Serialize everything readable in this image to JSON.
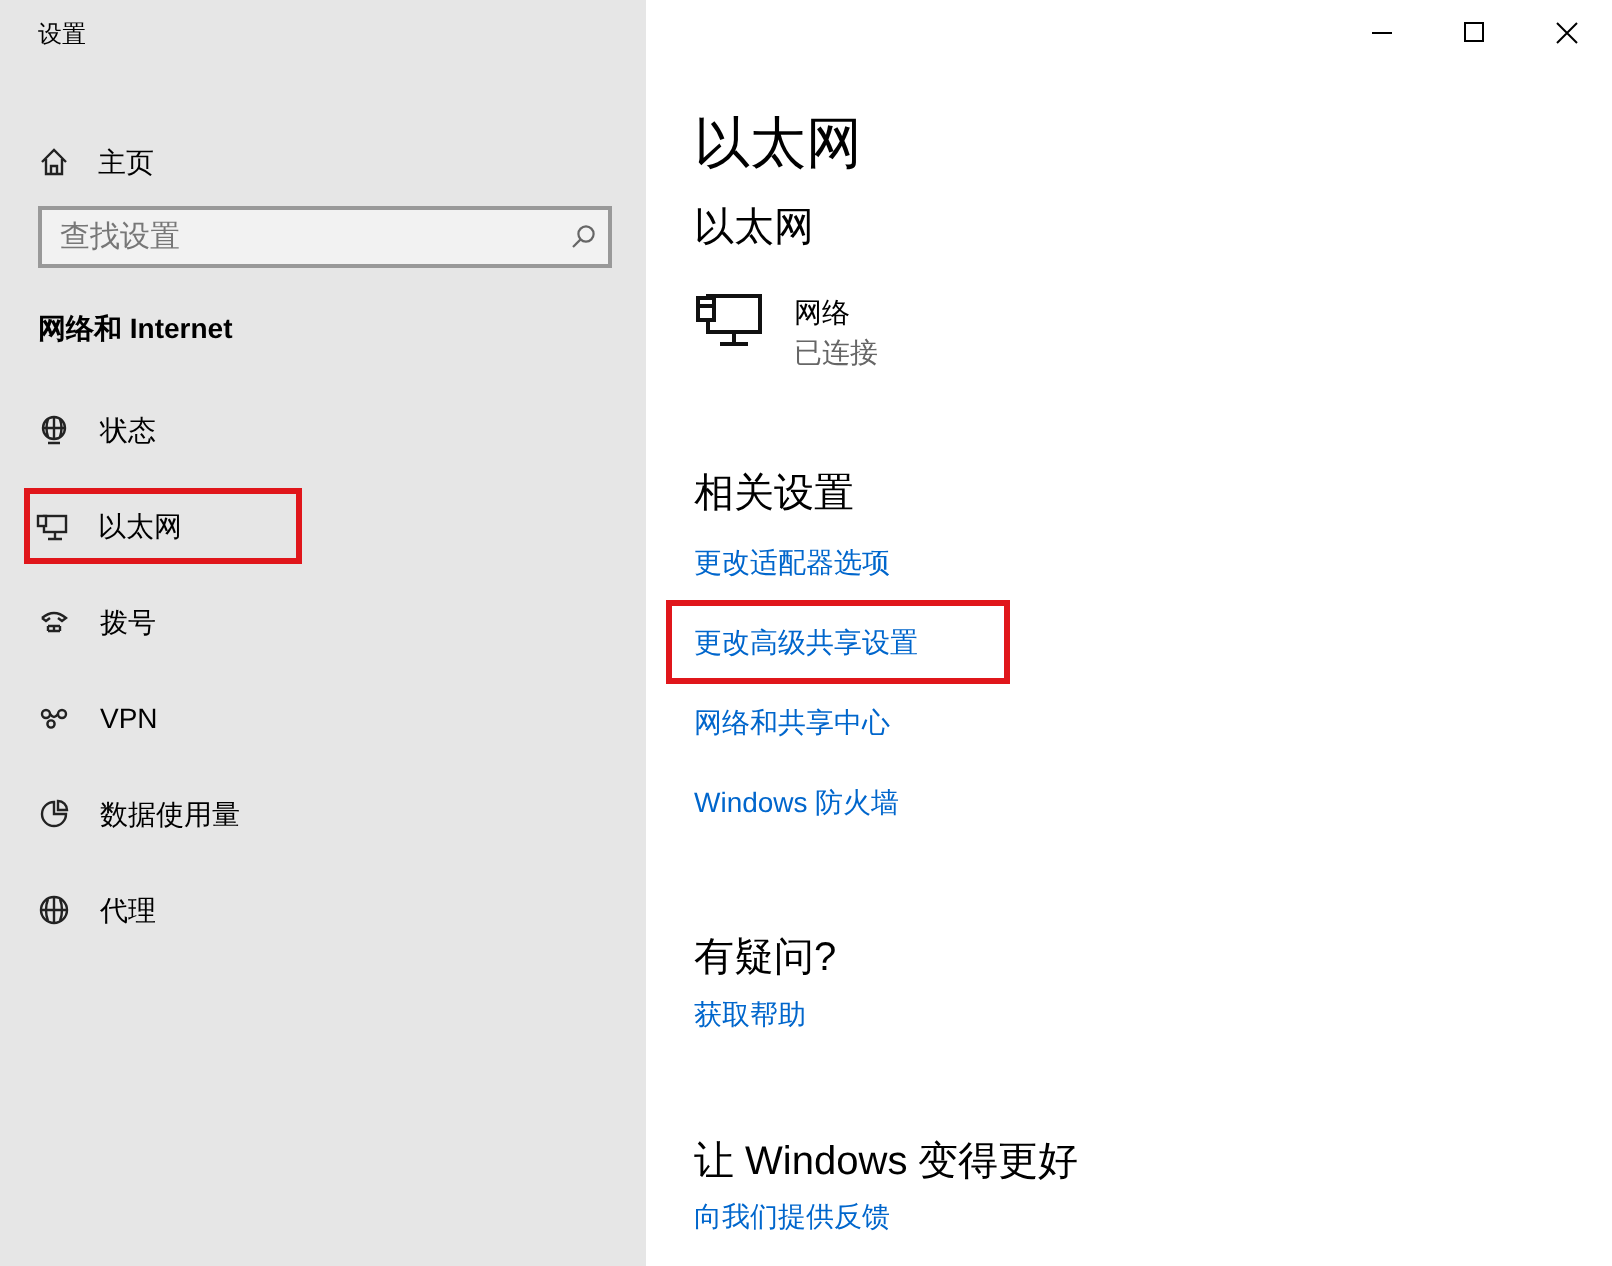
{
  "window": {
    "title": "设置"
  },
  "sidebar": {
    "home": "主页",
    "search": {
      "placeholder": "查找设置"
    },
    "section": "网络和 Internet",
    "items": [
      {
        "label": "状态",
        "kind": "status",
        "highlighted": false
      },
      {
        "label": "以太网",
        "kind": "ethernet",
        "highlighted": true
      },
      {
        "label": "拨号",
        "kind": "dialup",
        "highlighted": false
      },
      {
        "label": "VPN",
        "kind": "vpn",
        "highlighted": false
      },
      {
        "label": "数据使用量",
        "kind": "data",
        "highlighted": false
      },
      {
        "label": "代理",
        "kind": "proxy",
        "highlighted": false
      }
    ]
  },
  "content": {
    "title": "以太网",
    "subtitle": "以太网",
    "network": {
      "name": "网络",
      "status": "已连接"
    },
    "related": {
      "heading": "相关设置",
      "links": [
        {
          "label": "更改适配器选项",
          "highlighted": false
        },
        {
          "label": "更改高级共享设置",
          "highlighted": true
        },
        {
          "label": "网络和共享中心",
          "highlighted": false
        },
        {
          "label": "Windows 防火墙",
          "highlighted": false
        }
      ]
    },
    "help": {
      "heading": "有疑问?",
      "link": "获取帮助"
    },
    "feedback": {
      "heading": "让 Windows 变得更好",
      "link": "向我们提供反馈"
    }
  }
}
